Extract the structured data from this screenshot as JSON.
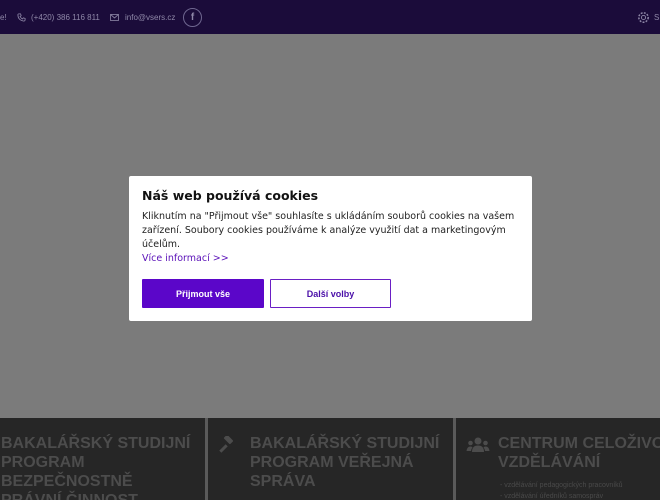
{
  "topbar": {
    "cut_text": "e!",
    "phone": "(+420) 386 116 811",
    "email": "info@vsers.cz",
    "facebook": "f",
    "right_cut": "S"
  },
  "cookie_dialog": {
    "title": "Náš web používá cookies",
    "body": "Kliknutím na \"Přijmout vše\" souhlasíte s ukládáním souborů cookies na vašem zařízení. Soubory cookies používáme k analýze využití dat a marketingovým účelům.",
    "more_link": "Více informací >>",
    "accept_label": "Přijmout vše",
    "settings_label": "Další volby"
  },
  "cards": [
    {
      "title_lines": [
        "BAKALÁŘSKÝ STUDIJNÍ",
        "PROGRAM BEZPEČNOSTNĚ",
        "PRÁVNÍ ČINNOST"
      ]
    },
    {
      "title_lines": [
        "BAKALÁŘSKÝ STUDIJNÍ",
        "PROGRAM VEŘEJNÁ",
        "SPRÁVA"
      ]
    },
    {
      "title_lines": [
        "CENTRUM CELOŽIVOT",
        "VZDĚLÁVÁNÍ"
      ],
      "sub_lines": [
        "- vzdělávání pedagogických pracovníků",
        "- vzdělávání úředníků samospráv"
      ]
    }
  ],
  "colors": {
    "topbar": "#1b0c3a",
    "accent": "#5b06c9",
    "overlay": "#7b7b7b"
  }
}
